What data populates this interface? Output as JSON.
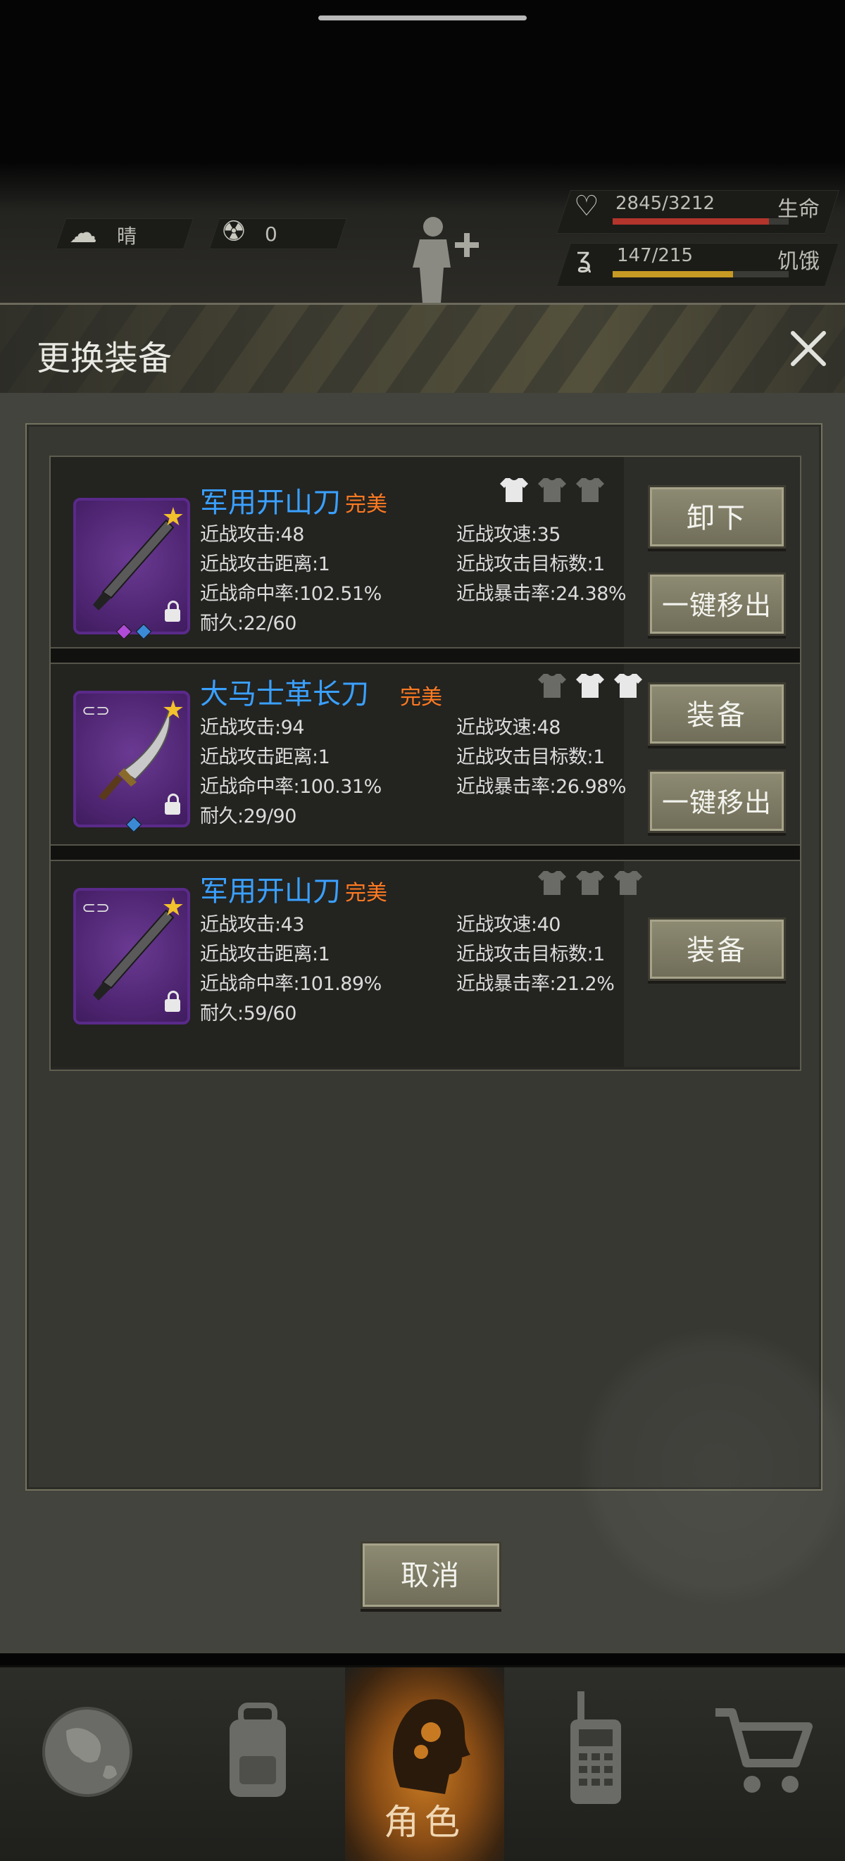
{
  "hud": {
    "weather": "晴",
    "radiation": "0",
    "health_value": "2845/3212",
    "health_label": "生命",
    "health_fraction": 0.886,
    "hunger_value": "147/215",
    "hunger_label": "饥饿",
    "hunger_fraction": 0.684
  },
  "modal": {
    "title": "更换装备",
    "cancel_label": "取消"
  },
  "items": [
    {
      "name": "军用开山刀",
      "quality": "完美",
      "stats": [
        "近战攻击:48",
        "近战攻速:35",
        "近战攻击距离:1",
        "近战攻击目标数:1",
        "近战命中率:102.51%",
        "近战暴击率:24.38%",
        "耐久:22/60"
      ],
      "buttons": [
        "卸下",
        "一键移出"
      ]
    },
    {
      "name": "大马士革长刀",
      "quality": "完美",
      "stats": [
        "近战攻击:94",
        "近战攻速:48",
        "近战攻击距离:1",
        "近战攻击目标数:1",
        "近战命中率:100.31%",
        "近战暴击率:26.98%",
        "耐久:29/90"
      ],
      "buttons": [
        "装备",
        "一键移出"
      ]
    },
    {
      "name": "军用开山刀",
      "quality": "完美",
      "stats": [
        "近战攻击:43",
        "近战攻速:40",
        "近战攻击距离:1",
        "近战攻击目标数:1",
        "近战命中率:101.89%",
        "近战暴击率:21.2%",
        "耐久:59/60"
      ],
      "buttons": [
        "装备"
      ]
    }
  ],
  "nav": {
    "role_label": "角色"
  },
  "colors": {
    "item_name": "#3aa0ff",
    "quality": "#ff7a22",
    "health_bar": "#b3352c",
    "hunger_bar": "#c79a24"
  }
}
